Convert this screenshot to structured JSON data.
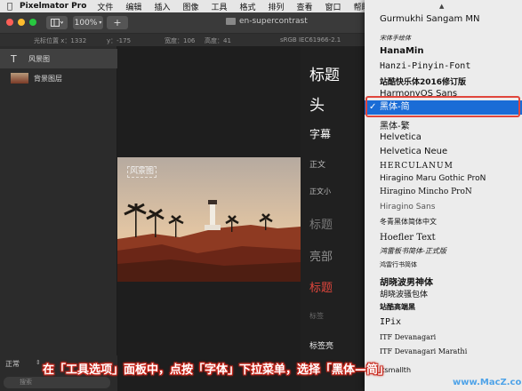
{
  "menubar": {
    "app_name": "Pixelmator Pro",
    "items": [
      "文件",
      "编辑",
      "插入",
      "图像",
      "工具",
      "格式",
      "排列",
      "查看",
      "窗口",
      "帮助"
    ]
  },
  "toolbar": {
    "zoom": "100%",
    "add_label": "+",
    "document_title": "en-supercontrast"
  },
  "infobar": {
    "cursor_label": "光标位置 x：1332",
    "cursor_y": "y：-175",
    "width": "宽度：106",
    "height": "高度：41",
    "color_profile": "sRGB IEC61966-2.1"
  },
  "layers": [
    {
      "name": "风景图",
      "selected": true
    },
    {
      "name": "背景图层",
      "selected": false
    }
  ],
  "canvas": {
    "text_layer_label": "风景图"
  },
  "styles": [
    "标题",
    "头",
    "字幕",
    "正文",
    "正文小",
    "标题",
    "亮部",
    "标题",
    "标签",
    "标签亮"
  ],
  "style_colors": {
    "white": "#ffffff",
    "dim": "#8a8a8a",
    "red": "#e0463c"
  },
  "fonts": [
    "Gurmukhi Sangam MN",
    "宋体手绘体",
    "HanaMin",
    "Hanzi-Pinyin-Font",
    "站酷快乐体2016修订版",
    "HarmonyOS Sans",
    "黑体-简",
    "黑体-繁",
    "Helvetica",
    "Helvetica Neue",
    "HERCULANUM",
    "Hiragino Maru Gothic ProN",
    "Hiragino Mincho ProN",
    "Hiragino Sans",
    "冬青黑体简体中文",
    "Hoefler Text",
    "鸿雷板书简体-正式版",
    "鸿雷行书简体",
    "胡晓波男神体",
    "胡晓波骚包体",
    "站酷高端黑",
    "IPix",
    "ITF Devanagari",
    "ITF Devanagari Marathi",
    "Itsmallth"
  ],
  "selected_font_check": "✓",
  "bottom": {
    "blend_mode": "正常",
    "search_placeholder": "搜索"
  },
  "caption": "在「工具选项」面板中，点按「字体」下拉菜单，选择「黑体—简」",
  "watermark": "www.MacZ.com"
}
